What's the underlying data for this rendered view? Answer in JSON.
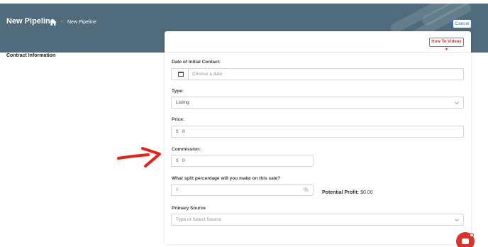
{
  "header": {
    "title": "New Pipeline",
    "breadcrumb_current": "New Pipeline",
    "cancel_label": "Cancel"
  },
  "section_label": "Contract Information",
  "card": {
    "how_to_videos_label": "How To Videos",
    "fields": {
      "date_initial_contact": {
        "label": "Date of Initial Contact:",
        "placeholder": "Choose a date"
      },
      "type": {
        "label": "Type:",
        "value": "Listing"
      },
      "price": {
        "label": "Price:",
        "prefix": "$",
        "value": "0"
      },
      "commission": {
        "label": "Commission:",
        "prefix": "$",
        "value": "0"
      },
      "split_percentage": {
        "label": "What split percentage will you make on this sale?",
        "value": "0",
        "suffix": "%"
      },
      "primary_source": {
        "label": "Primary Source",
        "placeholder": "Type or Select Source"
      }
    },
    "potential_profit": {
      "label": "Potential Profit:",
      "value": "$0.00"
    }
  },
  "icons": {
    "home": "home-icon",
    "calendar": "calendar-icon",
    "chat": "chat-icon",
    "arrow": "annotation-arrow"
  },
  "colors": {
    "header_bg": "#4f6b7c",
    "accent_red": "#d9342b",
    "accent_blue": "#3c75b5"
  }
}
